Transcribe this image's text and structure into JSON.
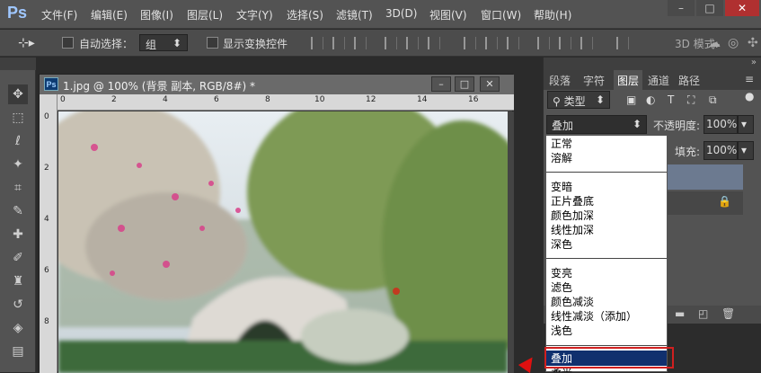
{
  "app": {
    "logo": "Ps"
  },
  "menubar": {
    "items": [
      "文件(F)",
      "编辑(E)",
      "图像(I)",
      "图层(L)",
      "文字(Y)",
      "选择(S)",
      "滤镜(T)",
      "3D(D)",
      "视图(V)",
      "窗口(W)",
      "帮助(H)"
    ],
    "window_controls": [
      "–",
      "□",
      "✕"
    ]
  },
  "options_bar": {
    "tool_icon": "move-tool-icon",
    "auto_select_label": "自动选择：",
    "auto_select_value": "组",
    "show_transform_label": "显示变换控件",
    "mode_3d_label": "3D 模式:"
  },
  "tools": [
    "move-icon",
    "marquee-icon",
    "lasso-icon",
    "magic-wand-icon",
    "crop-icon",
    "eyedropper-icon",
    "healing-brush-icon",
    "brush-icon",
    "clone-stamp-icon",
    "history-brush-icon",
    "eraser-icon",
    "gradient-icon"
  ],
  "document": {
    "icon": "Ps",
    "title": "1.jpg @ 100% (背景 副本, RGB/8#) *",
    "controls": [
      "–",
      "□",
      "✕"
    ],
    "ruler_h": [
      "0",
      "2",
      "4",
      "6",
      "8",
      "10",
      "12",
      "14",
      "16"
    ],
    "ruler_v": [
      "0",
      "2",
      "4",
      "6",
      "8"
    ]
  },
  "layers_panel": {
    "tabs": [
      "段落",
      "字符",
      "图层",
      "通道",
      "路径"
    ],
    "active_tab": "图层",
    "filter_type": "类型",
    "blend_mode": "叠加",
    "opacity_label": "不透明度:",
    "opacity_value": "100%",
    "fill_label": "填充:",
    "fill_value": "100%"
  },
  "blend_dropdown": {
    "groups": [
      [
        "正常",
        "溶解"
      ],
      [
        "变暗",
        "正片叠底",
        "颜色加深",
        "线性加深",
        "深色"
      ],
      [
        "变亮",
        "滤色",
        "颜色减淡",
        "线性减淡（添加）",
        "浅色"
      ],
      [
        "叠加",
        "柔光"
      ]
    ],
    "selected": "叠加"
  },
  "colors": {
    "highlight": "#10306e",
    "annotation": "#d02020"
  }
}
